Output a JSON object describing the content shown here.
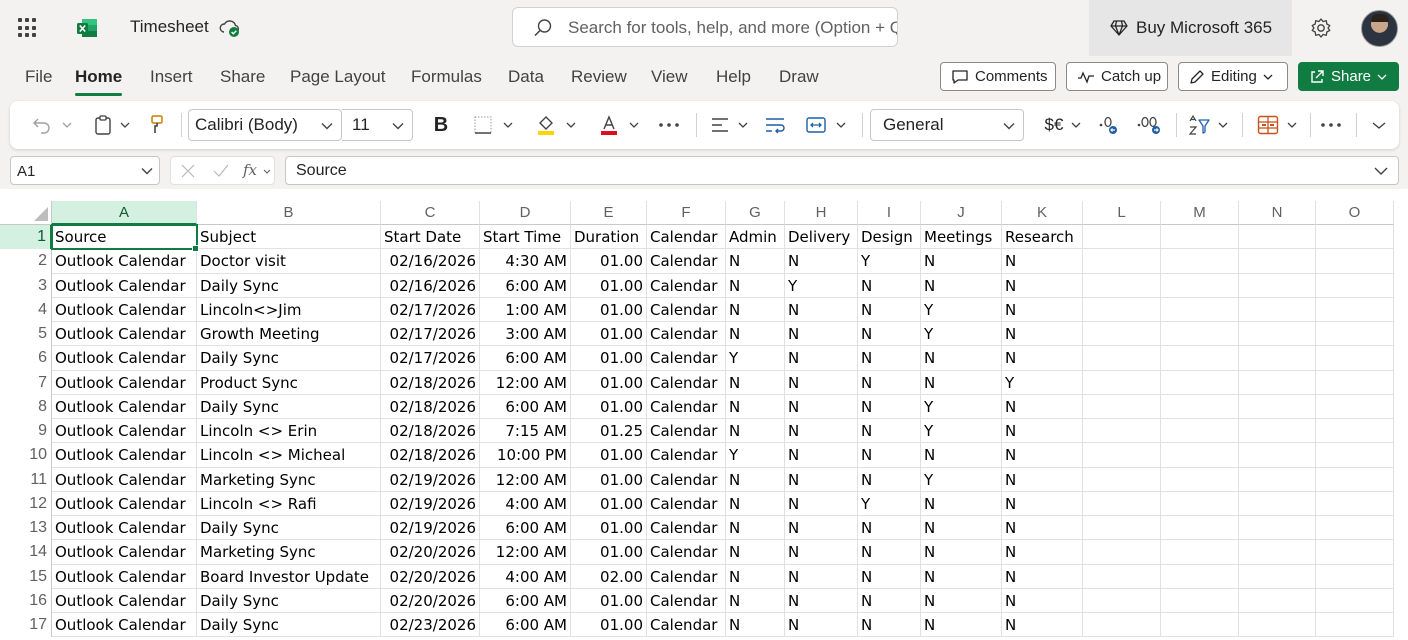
{
  "title_bar": {
    "app_icon": "excel-icon",
    "document_title": "Timesheet",
    "search_placeholder": "Search for tools, help, and more (Option + Q)",
    "buy_label": "Buy Microsoft 365",
    "brand_color": "#107c41"
  },
  "menu": {
    "tabs": [
      "File",
      "Home",
      "Insert",
      "Share",
      "Page Layout",
      "Formulas",
      "Data",
      "Review",
      "View",
      "Help",
      "Draw"
    ],
    "active_tab": "Home",
    "comments_label": "Comments",
    "catchup_label": "Catch up",
    "editing_label": "Editing",
    "share_label": "Share"
  },
  "ribbon": {
    "font_name": "Calibri (Body)",
    "font_size": "11",
    "bold_label": "B",
    "number_format": "General",
    "currency_label": "$€"
  },
  "formula_bar": {
    "name_box": "A1",
    "fx_label": "fx",
    "formula": "Source"
  },
  "sheet": {
    "columns": [
      "A",
      "B",
      "C",
      "D",
      "E",
      "F",
      "G",
      "H",
      "I",
      "J",
      "K",
      "L",
      "M",
      "N",
      "O"
    ],
    "selected_column": "A",
    "selected_row": "1",
    "rows": [
      {
        "n": "1",
        "cells": [
          "Source",
          "Subject",
          "Start Date",
          "Start Time",
          "Duration",
          "Calendar",
          "Admin",
          "Delivery",
          "Design",
          "Meetings",
          "Research"
        ]
      },
      {
        "n": "2",
        "cells": [
          "Outlook Calendar",
          "Doctor visit",
          "02/16/2026",
          "4:30 AM",
          "01.00",
          "Calendar",
          "N",
          "N",
          "Y",
          "N",
          "N"
        ]
      },
      {
        "n": "3",
        "cells": [
          "Outlook Calendar",
          "Daily Sync",
          "02/16/2026",
          "6:00 AM",
          "01.00",
          "Calendar",
          "N",
          "Y",
          "N",
          "N",
          "N"
        ]
      },
      {
        "n": "4",
        "cells": [
          "Outlook Calendar",
          "Lincoln<>Jim",
          "02/17/2026",
          "1:00 AM",
          "01.00",
          "Calendar",
          "N",
          "N",
          "N",
          "Y",
          "N"
        ]
      },
      {
        "n": "5",
        "cells": [
          "Outlook Calendar",
          "Growth Meeting",
          "02/17/2026",
          "3:00 AM",
          "01.00",
          "Calendar",
          "N",
          "N",
          "N",
          "Y",
          "N"
        ]
      },
      {
        "n": "6",
        "cells": [
          "Outlook Calendar",
          "Daily Sync",
          "02/17/2026",
          "6:00 AM",
          "01.00",
          "Calendar",
          "Y",
          "N",
          "N",
          "N",
          "N"
        ]
      },
      {
        "n": "7",
        "cells": [
          "Outlook Calendar",
          "Product Sync",
          "02/18/2026",
          "12:00 AM",
          "01.00",
          "Calendar",
          "N",
          "N",
          "N",
          "N",
          "Y"
        ]
      },
      {
        "n": "8",
        "cells": [
          "Outlook Calendar",
          "Daily Sync",
          "02/18/2026",
          "6:00 AM",
          "01.00",
          "Calendar",
          "N",
          "N",
          "N",
          "Y",
          "N"
        ]
      },
      {
        "n": "9",
        "cells": [
          "Outlook Calendar",
          "Lincoln <> Erin",
          "02/18/2026",
          "7:15 AM",
          "01.25",
          "Calendar",
          "N",
          "N",
          "N",
          "Y",
          "N"
        ]
      },
      {
        "n": "10",
        "cells": [
          "Outlook Calendar",
          "Lincoln <> Micheal",
          "02/18/2026",
          "10:00 PM",
          "01.00",
          "Calendar",
          "Y",
          "N",
          "N",
          "N",
          "N"
        ]
      },
      {
        "n": "11",
        "cells": [
          "Outlook Calendar",
          "Marketing Sync",
          "02/19/2026",
          "12:00 AM",
          "01.00",
          "Calendar",
          "N",
          "N",
          "N",
          "Y",
          "N"
        ]
      },
      {
        "n": "12",
        "cells": [
          "Outlook Calendar",
          "Lincoln <> Rafi",
          "02/19/2026",
          "4:00 AM",
          "01.00",
          "Calendar",
          "N",
          "N",
          "Y",
          "N",
          "N"
        ]
      },
      {
        "n": "13",
        "cells": [
          "Outlook Calendar",
          "Daily Sync",
          "02/19/2026",
          "6:00 AM",
          "01.00",
          "Calendar",
          "N",
          "N",
          "N",
          "N",
          "N"
        ]
      },
      {
        "n": "14",
        "cells": [
          "Outlook Calendar",
          "Marketing Sync",
          "02/20/2026",
          "12:00 AM",
          "01.00",
          "Calendar",
          "N",
          "N",
          "N",
          "N",
          "N"
        ]
      },
      {
        "n": "15",
        "cells": [
          "Outlook Calendar",
          "Board Investor Update",
          "02/20/2026",
          "4:00 AM",
          "02.00",
          "Calendar",
          "N",
          "N",
          "N",
          "N",
          "N"
        ]
      },
      {
        "n": "16",
        "cells": [
          "Outlook Calendar",
          "Daily Sync",
          "02/20/2026",
          "6:00 AM",
          "01.00",
          "Calendar",
          "N",
          "N",
          "N",
          "N",
          "N"
        ]
      },
      {
        "n": "17",
        "cells": [
          "Outlook Calendar",
          "Daily Sync",
          "02/23/2026",
          "6:00 AM",
          "01.00",
          "Calendar",
          "N",
          "N",
          "N",
          "N",
          "N"
        ]
      }
    ]
  }
}
